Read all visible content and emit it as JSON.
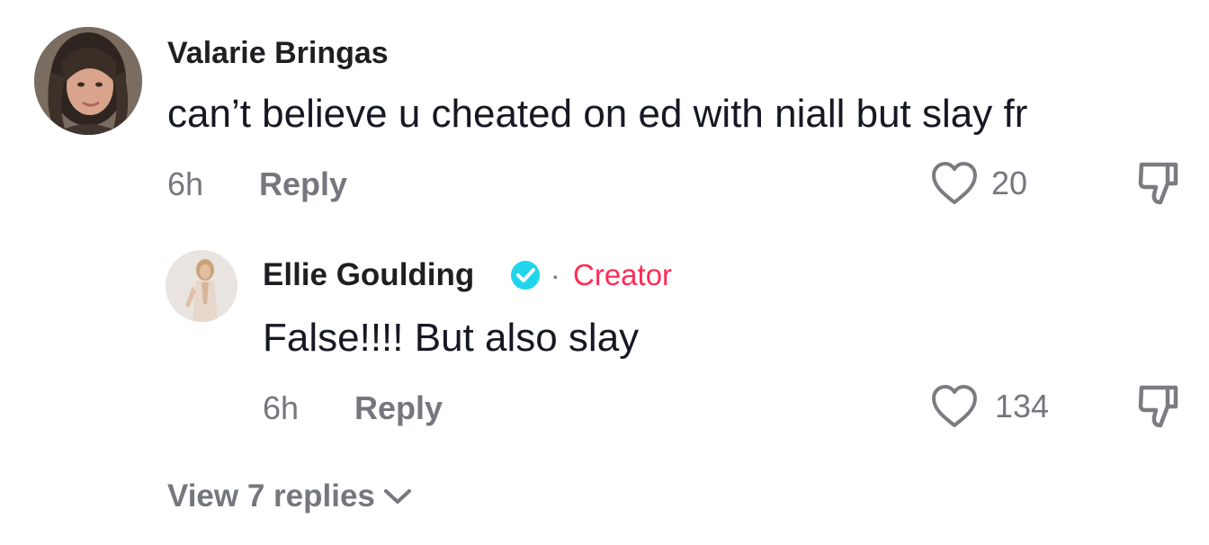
{
  "colors": {
    "text_primary": "#161823",
    "text_secondary": "#75777e",
    "creator_accent": "#fe2c55",
    "verified_blue": "#20d5ec"
  },
  "comment": {
    "author": "Valarie Bringas",
    "text": "can’t believe u cheated on ed with niall but slay fr",
    "time": "6h",
    "reply_label": "Reply",
    "likes": "20"
  },
  "reply": {
    "author": "Ellie Goulding",
    "separator": "·",
    "badge_label": "Creator",
    "text": "False!!!! But also slay",
    "time": "6h",
    "reply_label": "Reply",
    "likes": "134"
  },
  "view_replies_label": "View 7 replies",
  "icons": {
    "like": "heart-outline-icon",
    "dislike": "thumbs-down-icon",
    "verified": "verified-badge-icon",
    "expand": "chevron-down-icon"
  }
}
